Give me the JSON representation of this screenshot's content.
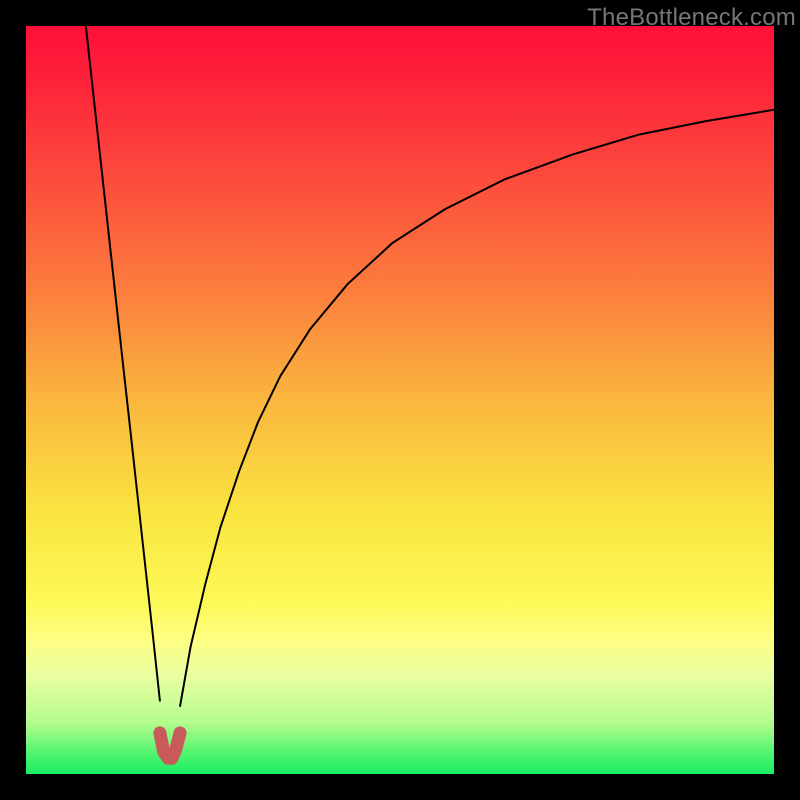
{
  "watermark": {
    "text": "TheBottleneck.com"
  },
  "colors": {
    "curve_stroke": "#000000",
    "marker_stroke": "#c95a5a",
    "background": "#000000"
  },
  "chart_data": {
    "type": "line",
    "title": "",
    "xlabel": "",
    "ylabel": "",
    "xlim": [
      0,
      100
    ],
    "ylim": [
      0,
      100
    ],
    "grid": false,
    "description": "Black bottleneck curve descending steeply from top-left to a minimum near x≈19, then rising gradually toward the right edge. Y is inverted visually (higher value = higher on screen). A short salmon U-shaped marker highlights the minimum.",
    "series": [
      {
        "name": "bottleneck-curve-left",
        "x": [
          8.0,
          9.0,
          10.0,
          11.0,
          12.0,
          13.0,
          14.0,
          15.0,
          16.0,
          17.0,
          17.9
        ],
        "y": [
          100.0,
          90.9,
          81.8,
          72.7,
          63.6,
          54.5,
          45.5,
          36.4,
          27.3,
          18.2,
          9.8
        ]
      },
      {
        "name": "bottleneck-curve-right",
        "x": [
          20.6,
          22.0,
          24.0,
          26.0,
          28.5,
          31.0,
          34.0,
          38.0,
          43.0,
          49.0,
          56.0,
          64.0,
          73.0,
          82.0,
          91.0,
          100.0
        ],
        "y": [
          9.1,
          17.0,
          25.5,
          33.0,
          40.5,
          47.0,
          53.2,
          59.5,
          65.5,
          71.0,
          75.5,
          79.5,
          82.8,
          85.5,
          87.3,
          88.8
        ]
      },
      {
        "name": "minimum-marker",
        "x": [
          17.9,
          18.4,
          19.0,
          19.2,
          19.5,
          20.0,
          20.6
        ],
        "y": [
          5.5,
          3.0,
          2.1,
          2.1,
          2.1,
          3.2,
          5.5
        ]
      }
    ]
  }
}
